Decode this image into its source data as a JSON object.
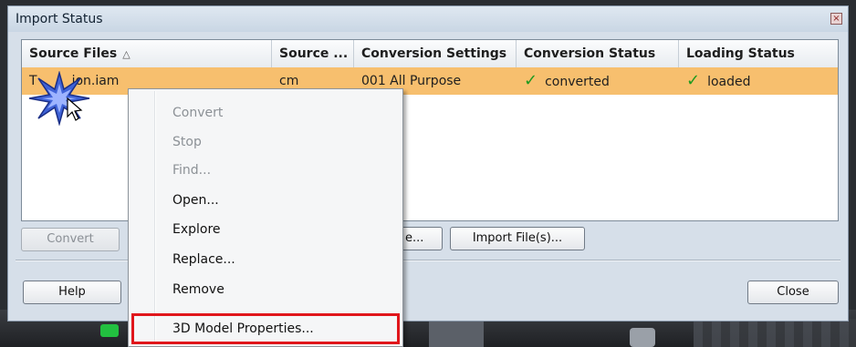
{
  "window": {
    "title": "Import Status",
    "close_glyph": "×"
  },
  "grid": {
    "columns": [
      {
        "label": "Source Files",
        "sort_icon": "sort-ascending-icon"
      },
      {
        "label": "Source ..."
      },
      {
        "label": "Conversion Settings"
      },
      {
        "label": "Conversion Status"
      },
      {
        "label": "Loading Status"
      }
    ],
    "rows": [
      {
        "source_file": "T...ion.iam",
        "source_file_visible_start": "T",
        "source_file_visible_end": "ion.iam",
        "source_units": "cm",
        "conversion_settings": "001 All Purpose",
        "conversion_status": "converted",
        "loading_status": "loaded",
        "selected": true
      }
    ]
  },
  "buttons": {
    "convert": "Convert",
    "hidden_partial": "e...",
    "import_files": "Import File(s)...",
    "help": "Help",
    "close": "Close"
  },
  "context_menu": {
    "items": [
      {
        "label": "Convert",
        "enabled": false
      },
      {
        "label": "Stop",
        "enabled": false
      },
      {
        "label": "Find...",
        "enabled": false
      },
      {
        "label": "Open...",
        "enabled": true
      },
      {
        "label": "Explore",
        "enabled": true
      },
      {
        "label": "Replace...",
        "enabled": true
      },
      {
        "label": "Remove",
        "enabled": true
      },
      {
        "label": "3D Model Properties...",
        "enabled": true,
        "highlighted": true
      }
    ]
  },
  "colors": {
    "selected_row": "#f7bf6e",
    "highlight_border": "#e0161b",
    "check_green": "#1f9a1f",
    "dialog_bg": "#d6dfe9"
  }
}
